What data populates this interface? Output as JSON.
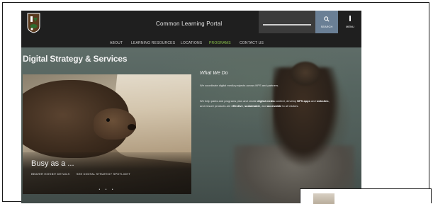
{
  "header": {
    "portal_title": "Common Learning Portal",
    "search_label": "SEARCH",
    "menu_label": "MENU",
    "search_placeholder": ""
  },
  "nav": {
    "items": [
      {
        "label": "ABOUT",
        "active": false
      },
      {
        "label": "LEARNING RESOURCES",
        "active": false
      },
      {
        "label": "LOCATIONS",
        "active": false
      },
      {
        "label": "PROGRAMS",
        "active": true
      },
      {
        "label": "CONTACT US",
        "active": false
      }
    ]
  },
  "page": {
    "title": "Digital Strategy & Services"
  },
  "feature": {
    "caption": "Busy as a ...",
    "links": [
      "BEAVER EXHIBIT DETAILS",
      "SEE DIGITAL STRATEGY SPOTLIGHT"
    ]
  },
  "what_we_do": {
    "title": "What We Do",
    "paragraph1": "We coordinate digital media projects across NPS and partners.",
    "paragraph2_parts": [
      {
        "text": "We help parks and programs plan and create ",
        "bold": false
      },
      {
        "text": "digital media",
        "bold": true
      },
      {
        "text": " content, develop ",
        "bold": false
      },
      {
        "text": "NPS apps",
        "bold": true
      },
      {
        "text": " and ",
        "bold": false
      },
      {
        "text": "websites",
        "bold": true
      },
      {
        "text": ", and ensure products are ",
        "bold": false
      },
      {
        "text": "effective",
        "bold": true
      },
      {
        "text": ", ",
        "bold": false
      },
      {
        "text": "sustainable",
        "bold": true
      },
      {
        "text": ", and ",
        "bold": false
      },
      {
        "text": "accessible",
        "bold": true
      },
      {
        "text": " to all visitors.",
        "bold": false
      }
    ]
  },
  "colors": {
    "header_bg": "#1f1f1f",
    "search_button": "#6a7f95",
    "nav_active": "#8bc34a"
  },
  "icons": [
    "nps-arrowhead-logo",
    "search-icon",
    "menu-icon"
  ]
}
